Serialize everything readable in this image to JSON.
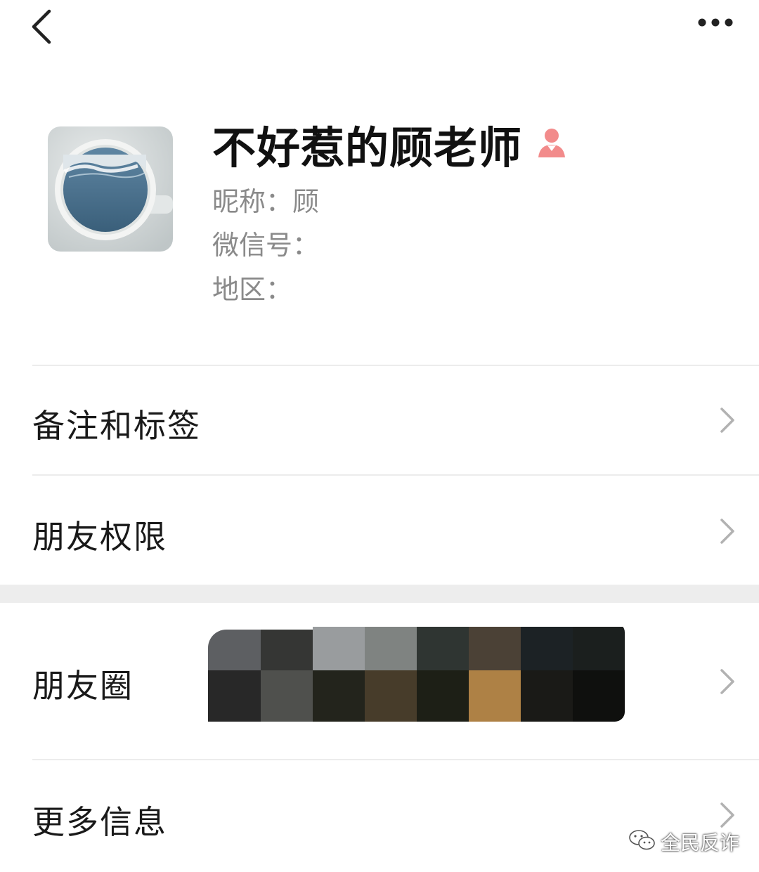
{
  "header": {
    "back_icon": "chevron-left-icon",
    "more_icon": "ellipsis-icon"
  },
  "profile": {
    "display_name": "不好惹的顾老师",
    "gender_icon": "female-user-icon",
    "gender_color": "#f28b8b",
    "nickname_label": "昵称：",
    "nickname_value": "顾",
    "wechat_id_label": "微信号：",
    "region_label": "地区："
  },
  "rows": {
    "remark": "备注和标签",
    "permissions": "朋友权限",
    "moments": "朋友圈",
    "more_info": "更多信息"
  },
  "watermark": {
    "icon": "wechat-official-account-icon",
    "text": "全民反诈"
  },
  "colors": {
    "divider": "#ececec",
    "section_gap": "#ededed",
    "secondary_text": "#8a8a8a"
  }
}
